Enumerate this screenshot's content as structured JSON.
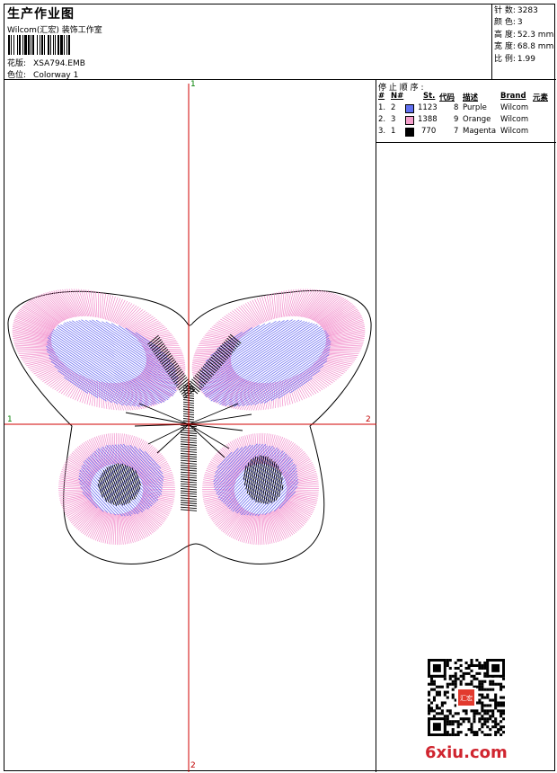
{
  "header": {
    "title": "生产作业图",
    "company": "Wilcom(汇宏) 装饰工作室",
    "pattern_label": "花版:",
    "pattern_value": "XSA794.EMB",
    "colorway_label": "色位:",
    "colorway_value": "Colorway 1"
  },
  "stats": {
    "stitches_label": "针 数:",
    "stitches": "3283",
    "colors_label": "颜 色:",
    "colors": "3",
    "height_label": "高 度:",
    "height": "52.3 mm",
    "width_label": "宽 度:",
    "width": "68.8 mm",
    "ratio_label": "比 例:",
    "ratio": "1.99"
  },
  "axes": {
    "top": "1",
    "bottom": "2",
    "left": "1",
    "right": "2"
  },
  "color_table": {
    "title": "停 止 顺 序 :",
    "headers": [
      "#",
      "N#",
      "St.",
      "代码",
      "描述",
      "Brand",
      "元素"
    ],
    "rows": [
      {
        "num": "1.",
        "n": "2",
        "st": "1123",
        "code": "8",
        "desc": "Purple",
        "brand": "Wilcom",
        "color": "#6070f0"
      },
      {
        "num": "2.",
        "n": "3",
        "st": "1388",
        "code": "9",
        "desc": "Orange",
        "brand": "Wilcom",
        "color": "#f5a0cc"
      },
      {
        "num": "3.",
        "n": "1",
        "st": "770",
        "code": "7",
        "desc": "Magenta",
        "brand": "Wilcom",
        "color": "#000000"
      }
    ]
  },
  "watermark": "6xiu.com",
  "stamp_text": "汇宏"
}
